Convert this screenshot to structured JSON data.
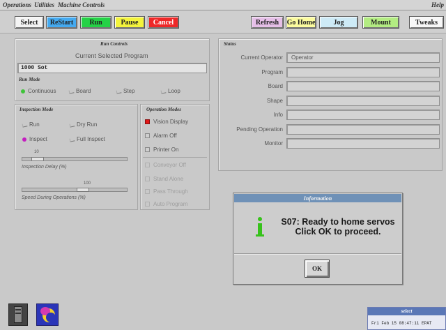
{
  "menu": {
    "operations": "Operations",
    "utilities": "Utilities",
    "machine_controls": "Machine Controls",
    "help": "Help"
  },
  "toolbar": {
    "select": "Select",
    "restart": "ReStart",
    "run": "Run",
    "pause": "Pause",
    "cancel": "Cancel",
    "refresh": "Refresh",
    "go_home": "Go Home",
    "jog": "Jog",
    "mount": "Mount",
    "tweaks": "Tweaks"
  },
  "colors": {
    "restart": "#44aaf0",
    "run": "#25d246",
    "pause": "#f4f43c",
    "cancel": "#ee2828",
    "refresh": "#e6bfe8",
    "go_home": "#fbfb9e",
    "jog": "#cdeaf6",
    "mount": "#b3ec82",
    "tweaks": "#f7f7f7",
    "info_icon": "#37c21b",
    "title_bar": "#6f91b7"
  },
  "run_controls": {
    "title": "Run Controls",
    "current_program_label": "Current Selected Program",
    "program_value": "1000 Sot",
    "run_mode_title": "Run Mode",
    "modes": [
      "Continuous",
      "Board",
      "Step",
      "Loop"
    ]
  },
  "inspection": {
    "title": "Inspection Mode",
    "options": [
      "Run",
      "Dry Run",
      "Inspect",
      "Full Inspect"
    ],
    "delay_value": "10",
    "delay_label": "Inspection Delay (%)",
    "speed_value": "100",
    "speed_label": "Speed During Operations (%)",
    "delay_level_fraction": 0.1,
    "speed_level_fraction": 0.6
  },
  "operation_modes": {
    "title": "Operation Modes",
    "items": [
      "Vision Display",
      "Alarm Off",
      "Printer On",
      "Conveyor Off",
      "Stand Alone",
      "Pass Through",
      "Auto Program"
    ]
  },
  "status": {
    "title": "Status",
    "rows": [
      {
        "label": "Current Operator",
        "value": "Operator"
      },
      {
        "label": "Program",
        "value": ""
      },
      {
        "label": "Board",
        "value": ""
      },
      {
        "label": "Shape",
        "value": ""
      },
      {
        "label": "Info",
        "value": ""
      },
      {
        "label": "Pending Operation",
        "value": ""
      },
      {
        "label": "Monitor",
        "value": ""
      }
    ]
  },
  "dialog": {
    "title": "Information",
    "icon": "info-icon",
    "message_line1": "S07: Ready to home servos",
    "message_line2": "Click OK to proceed.",
    "ok": "OK"
  },
  "mini_window": {
    "title": "select",
    "clock": "Fri Feb 15 08:47:11 EPAT"
  },
  "dock": {
    "icon1": "server-icon",
    "icon2": "launcher-icon"
  }
}
